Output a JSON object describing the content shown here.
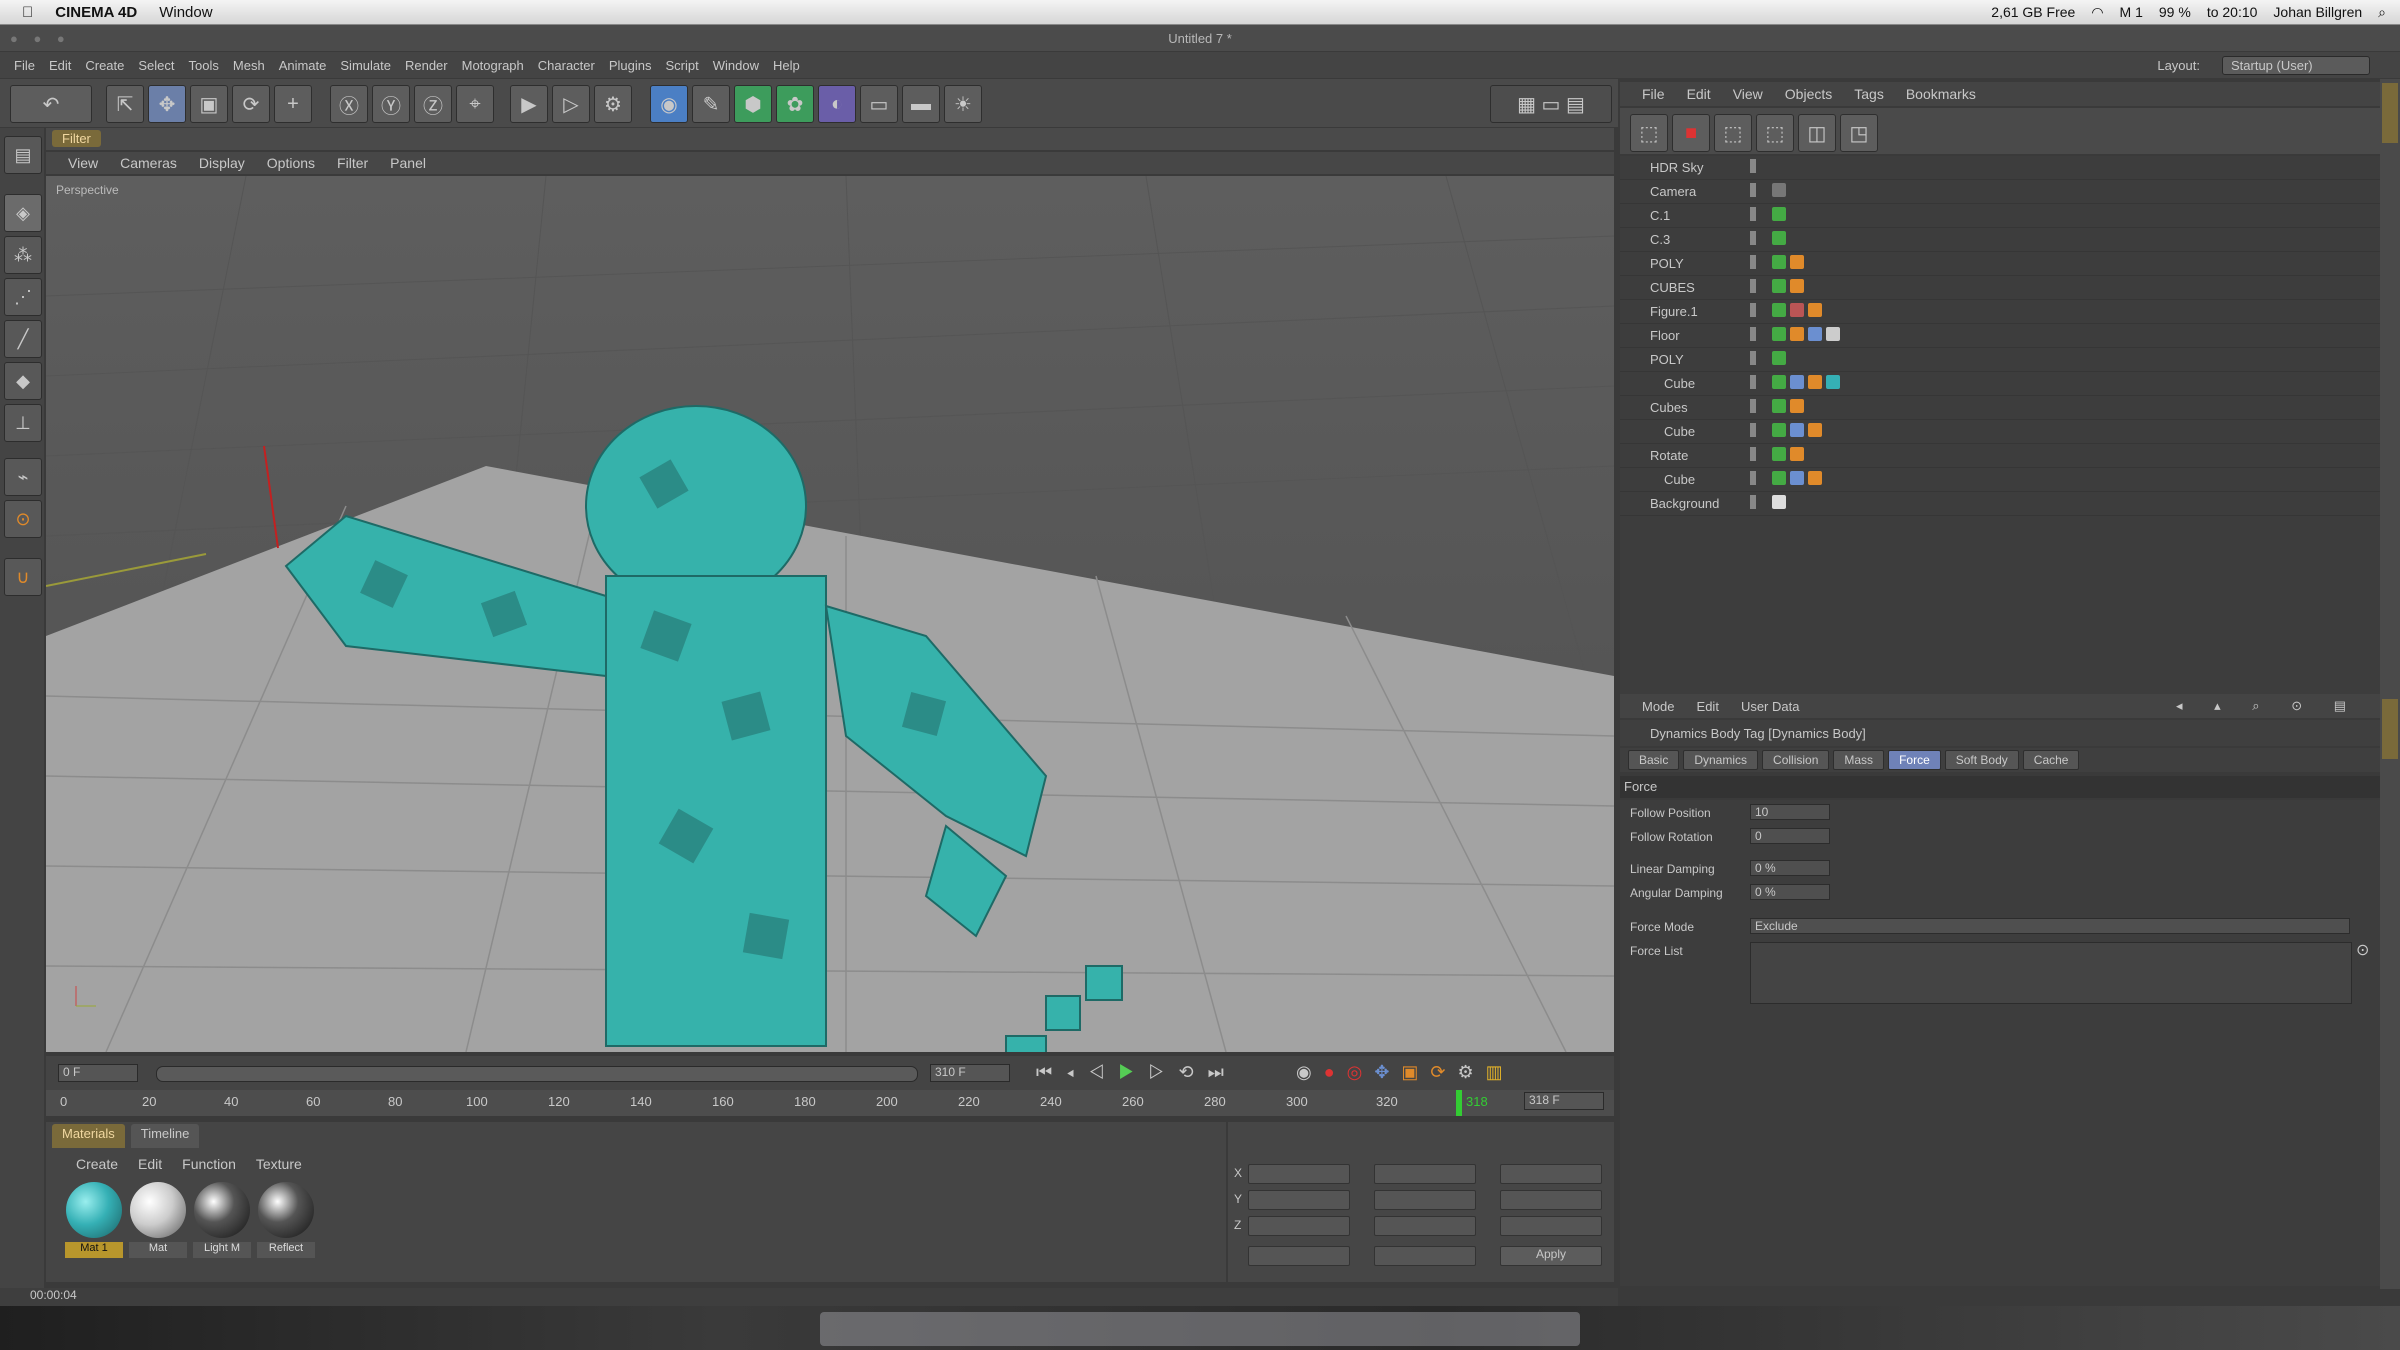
{
  "os_menubar": {
    "apple": "",
    "app": "CINEMA 4D",
    "window": "Window",
    "status_items": [
      "2,61 GB Free",
      "M 1",
      "99 %",
      "to 20:10",
      "Johan Billgren"
    ]
  },
  "window_title": "Untitled 7 *",
  "app_menu": [
    "File",
    "Edit",
    "Create",
    "Select",
    "Tools",
    "Mesh",
    "Animate",
    "Simulate",
    "Render",
    "Motograph",
    "Character",
    "Plugins",
    "Script",
    "Window",
    "Help"
  ],
  "layout_label": "Layout:",
  "layout_value": "Startup (User)",
  "viewport": {
    "tab": "Filter",
    "menu": [
      "View",
      "Cameras",
      "Display",
      "Options",
      "Filter",
      "Panel"
    ],
    "camera_label": "Perspective"
  },
  "timeline": {
    "start_field": "0 F",
    "end_field": "310 F",
    "current_frame": "318",
    "end_display": "318 F",
    "ticks": [
      "0",
      "20",
      "40",
      "60",
      "80",
      "100",
      "120",
      "140",
      "160",
      "180",
      "200",
      "220",
      "240",
      "260",
      "280",
      "300",
      "320"
    ]
  },
  "materials": {
    "tabs": [
      "Materials",
      "Timeline"
    ],
    "menu": [
      "Create",
      "Edit",
      "Function",
      "Texture"
    ],
    "items": [
      {
        "label": "Mat 1",
        "color": "#35b0b5"
      },
      {
        "label": "Mat",
        "color": "#e0e0e0"
      },
      {
        "label": "Light M",
        "color": "#2b2b2b"
      },
      {
        "label": "Reflect",
        "color": "#2b2b2b"
      }
    ]
  },
  "coords": {
    "axes": [
      "X",
      "Y",
      "Z"
    ],
    "apply": "Apply"
  },
  "status_time": "00:00:04",
  "object_manager": {
    "menu": [
      "File",
      "Edit",
      "View",
      "Objects",
      "Tags",
      "Bookmarks"
    ],
    "objects": [
      {
        "name": "HDR Sky",
        "indent": 0
      },
      {
        "name": "Camera",
        "indent": 0
      },
      {
        "name": "C.1",
        "indent": 0
      },
      {
        "name": "C.3",
        "indent": 0
      },
      {
        "name": "POLY",
        "indent": 0
      },
      {
        "name": "CUBES",
        "indent": 0
      },
      {
        "name": "Figure.1",
        "indent": 0
      },
      {
        "name": "Floor",
        "indent": 0
      },
      {
        "name": "POLY",
        "indent": 0
      },
      {
        "name": "Cube",
        "indent": 1
      },
      {
        "name": "Cubes",
        "indent": 0
      },
      {
        "name": "Cube",
        "indent": 1
      },
      {
        "name": "Rotate",
        "indent": 0
      },
      {
        "name": "Cube",
        "indent": 1
      },
      {
        "name": "Background",
        "indent": 0
      }
    ]
  },
  "attribute_manager": {
    "menu": [
      "Mode",
      "Edit",
      "User Data"
    ],
    "title": "Dynamics Body Tag [Dynamics Body]",
    "tabs": [
      "Basic",
      "Dynamics",
      "Collision",
      "Mass",
      "Force",
      "Soft Body",
      "Cache"
    ],
    "active_tab": "Force",
    "section": "Force",
    "params": [
      {
        "label": "Follow Position",
        "value": "10"
      },
      {
        "label": "Follow Rotation",
        "value": "0"
      },
      {
        "label": "Linear Damping",
        "value": "0 %"
      },
      {
        "label": "Angular Damping",
        "value": "0 %"
      }
    ],
    "force_mode_label": "Force Mode",
    "force_mode_value": "Exclude",
    "force_list_label": "Force List"
  }
}
